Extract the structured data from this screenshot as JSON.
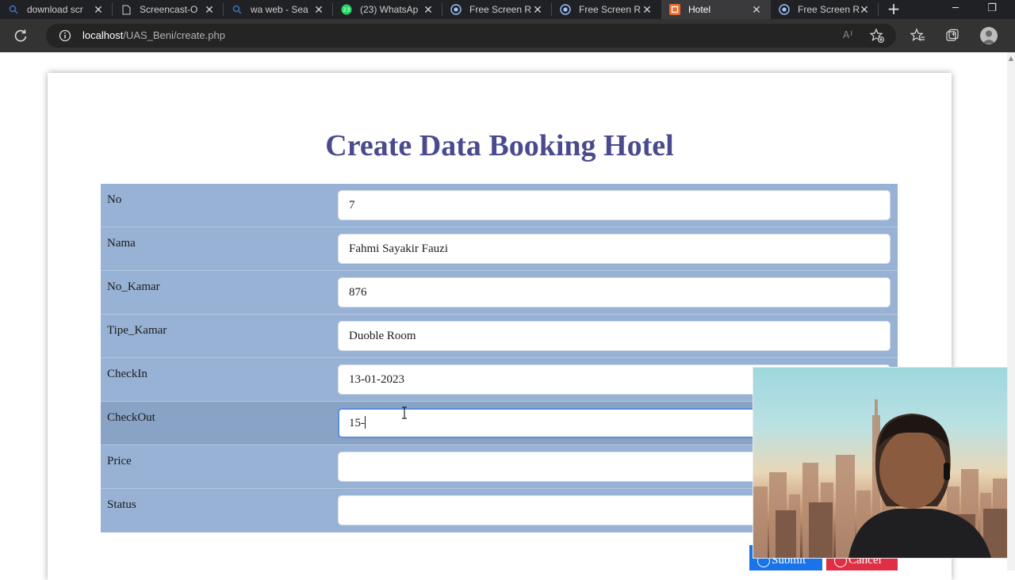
{
  "browser": {
    "tabs": [
      {
        "label": "download scr",
        "icon": "search-icon"
      },
      {
        "label": "Screencast-O",
        "icon": "document-icon"
      },
      {
        "label": "wa web - Sea",
        "icon": "search-icon"
      },
      {
        "label": "(23) WhatsAp",
        "icon": "whatsapp-icon"
      },
      {
        "label": "Free Screen R",
        "icon": "record-icon"
      },
      {
        "label": "Free Screen R",
        "icon": "record-icon"
      },
      {
        "label": "Hotel",
        "icon": "hotel-site-icon",
        "active": true
      },
      {
        "label": "Free Screen R",
        "icon": "record-icon"
      }
    ],
    "whatsapp_badge": "23",
    "url_host": "localhost",
    "url_path": "/UAS_Beni/create.php",
    "toolbar_icons": [
      "read-aloud-icon",
      "add-favorite-icon",
      "favorites-icon",
      "collections-icon",
      "profile-icon"
    ]
  },
  "form": {
    "title": "Create Data Booking Hotel",
    "fields": [
      {
        "label": "No",
        "value": "7"
      },
      {
        "label": "Nama",
        "value": "Fahmi Sayakir Fauzi"
      },
      {
        "label": "No_Kamar",
        "value": "876"
      },
      {
        "label": "Tipe_Kamar",
        "value": "Duoble Room"
      },
      {
        "label": "CheckIn",
        "value": "13-01-2023"
      },
      {
        "label": "CheckOut",
        "value": "15-",
        "focused": true
      },
      {
        "label": "Price",
        "value": ""
      },
      {
        "label": "Status",
        "value": ""
      }
    ],
    "submit_label": "Submit",
    "cancel_label": "Cancel"
  },
  "colors": {
    "title": "#4b4a8f",
    "row_bg": "#97b2d5",
    "submit": "#1a73e8",
    "cancel": "#de2f45"
  }
}
